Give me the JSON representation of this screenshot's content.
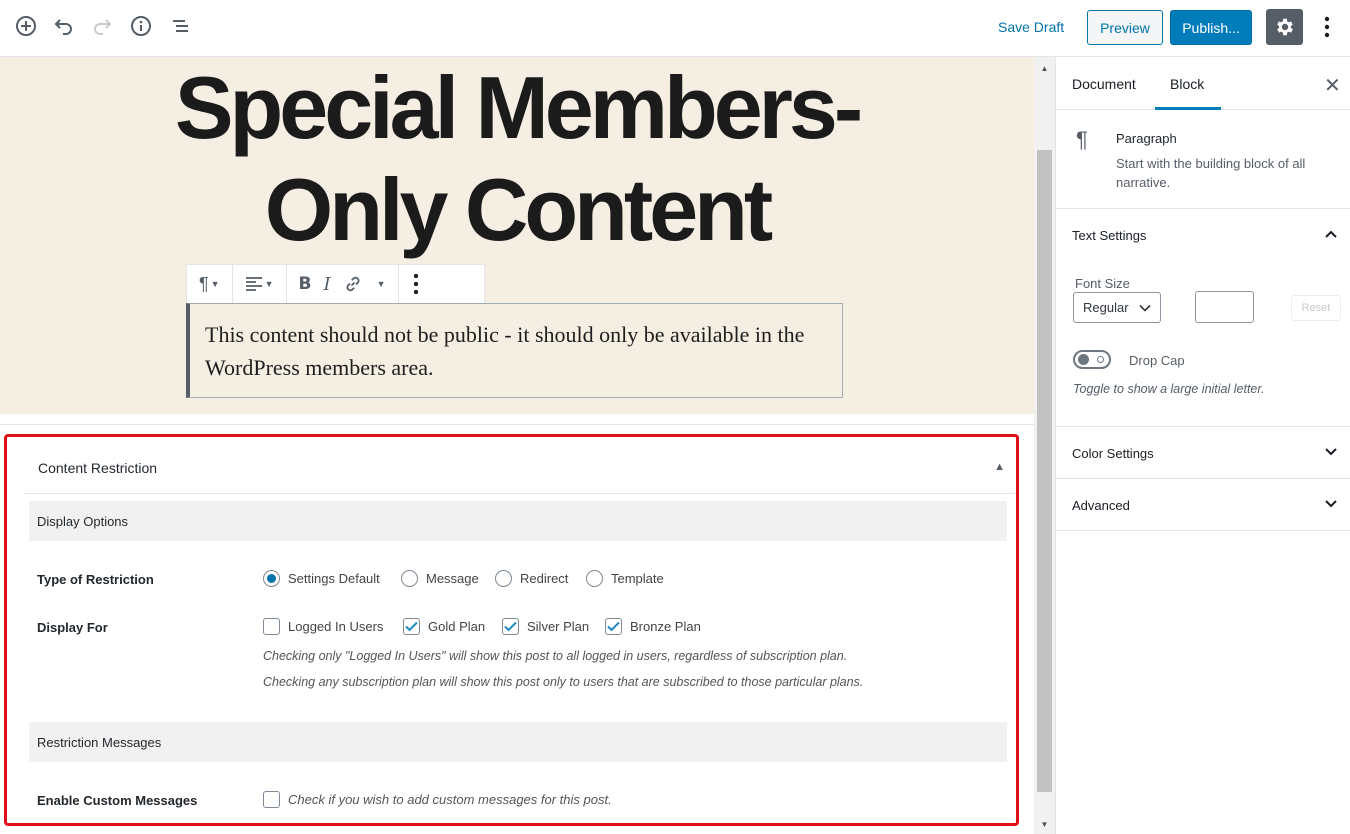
{
  "toolbar": {
    "save_draft": "Save Draft",
    "preview": "Preview",
    "publish": "Publish..."
  },
  "post": {
    "title_line1": "Special Members-",
    "title_line2": "Only Content",
    "paragraph": "This content should not be public - it should only be available in the WordPress members area."
  },
  "content_restriction": {
    "title": "Content Restriction",
    "display_options": "Display Options",
    "type_label": "Type of Restriction",
    "type_options": [
      {
        "label": "Settings Default",
        "selected": true
      },
      {
        "label": "Message",
        "selected": false
      },
      {
        "label": "Redirect",
        "selected": false
      },
      {
        "label": "Template",
        "selected": false
      }
    ],
    "display_for_label": "Display For",
    "display_for_options": [
      {
        "label": "Logged In Users",
        "checked": false
      },
      {
        "label": "Gold Plan",
        "checked": true
      },
      {
        "label": "Silver Plan",
        "checked": true
      },
      {
        "label": "Bronze Plan",
        "checked": true
      }
    ],
    "help1": "Checking only \"Logged In Users\" will show this post to all logged in users, regardless of subscription plan.",
    "help2": "Checking any subscription plan will show this post only to users that are subscribed to those particular plans.",
    "restriction_messages": "Restriction Messages",
    "custom_label": "Enable Custom Messages",
    "custom_help": "Check if you wish to add custom messages for this post.",
    "custom_checked": false
  },
  "sidebar": {
    "tab_document": "Document",
    "tab_block": "Block",
    "block_name": "Paragraph",
    "block_desc": "Start with the building block of all narrative.",
    "text_settings": "Text Settings",
    "font_size_label": "Font Size",
    "font_size_value": "Regular",
    "reset": "Reset",
    "drop_cap": "Drop Cap",
    "drop_cap_help": "Toggle to show a large initial letter.",
    "color_settings": "Color Settings",
    "advanced": "Advanced"
  },
  "colors": {
    "accent": "#007cba",
    "highlight_border": "#e0101a",
    "hero_bg": "#f5efe3"
  }
}
